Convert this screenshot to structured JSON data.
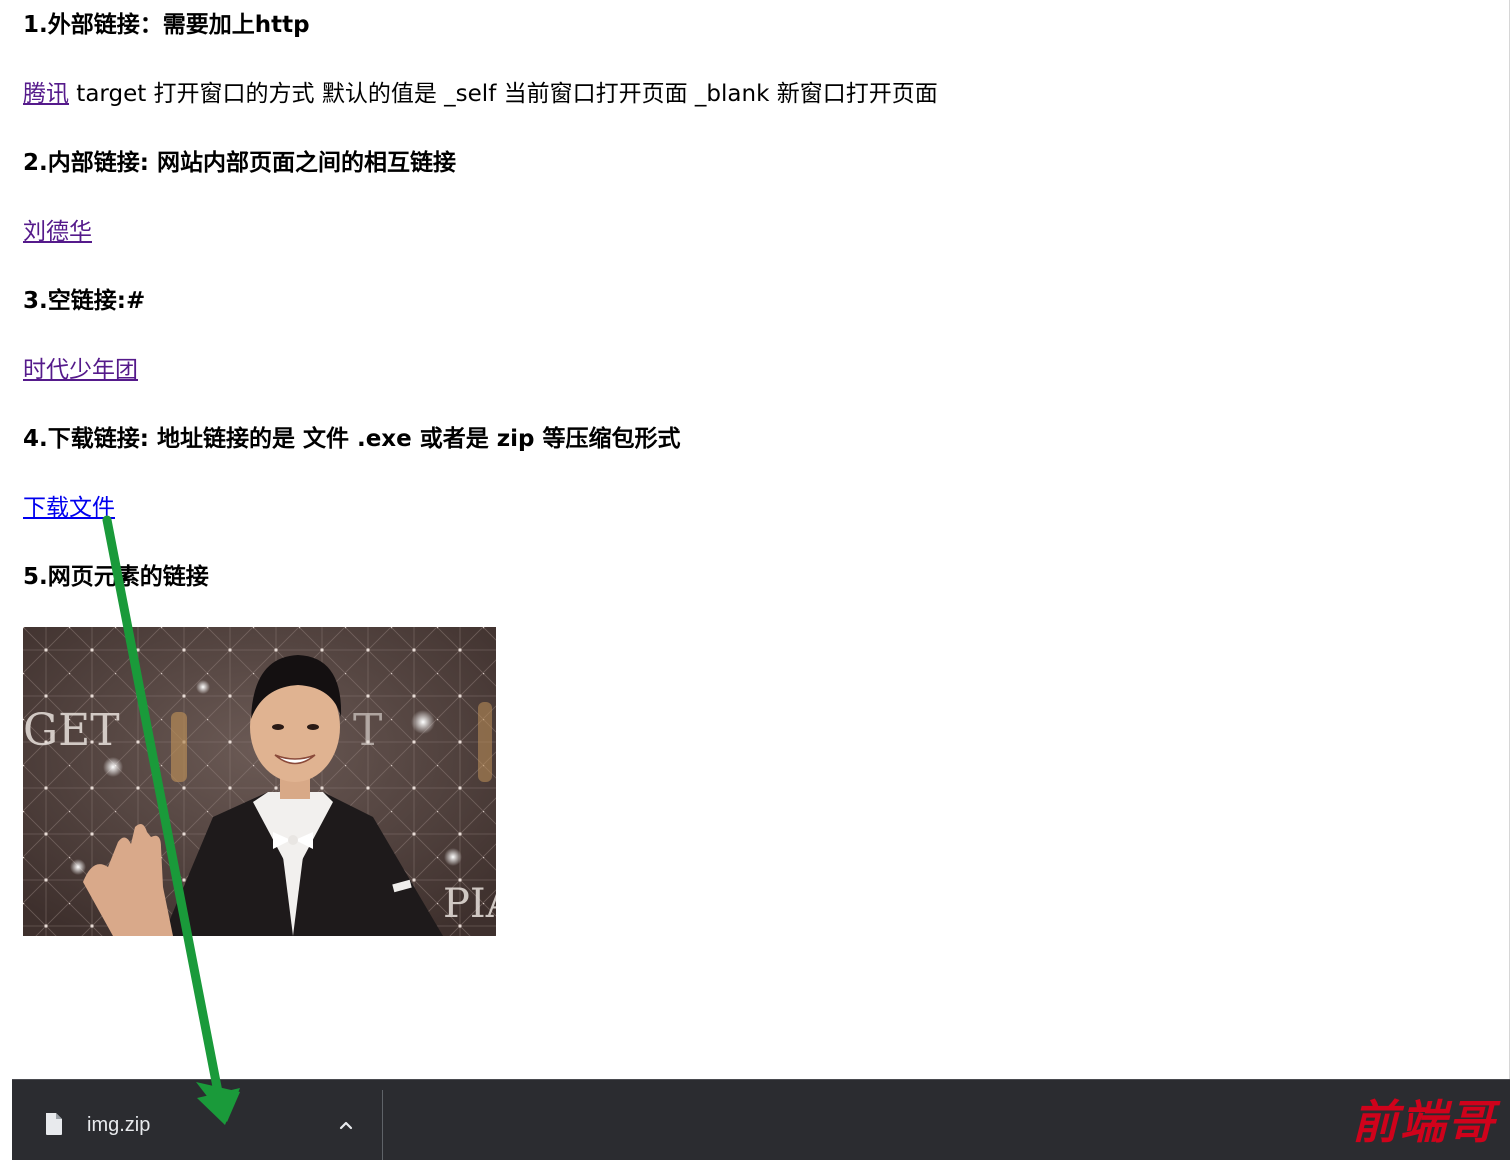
{
  "content": {
    "h1": "1.外部链接：需要加上http",
    "tencent_link": "腾讯",
    "target_note": " target 打开窗口的方式 默认的值是 _self 当前窗口打开页面 _blank 新窗口打开页面",
    "h2": "2.内部链接: 网站内部页面之间的相互链接",
    "liudehua_link": "刘德华",
    "h3": "3.空链接:#",
    "tfboys_link": "时代少年团",
    "h4": "4.下载链接: 地址链接的是 文件 .exe 或者是 zip 等压缩包形式",
    "download_link": "下载文件",
    "h5": "5.网页元素的链接"
  },
  "download_bar": {
    "file_name": "img.zip",
    "file_icon": "file-icon",
    "caret_icon": "chevron-up-icon"
  },
  "watermark": "前端哥",
  "colors": {
    "visited_link": "#551a8b",
    "unvisited_link": "#0000ee",
    "download_bar_bg": "#2b2c30",
    "annotation_arrow": "#1a9a3a",
    "watermark": "#d0021b"
  }
}
